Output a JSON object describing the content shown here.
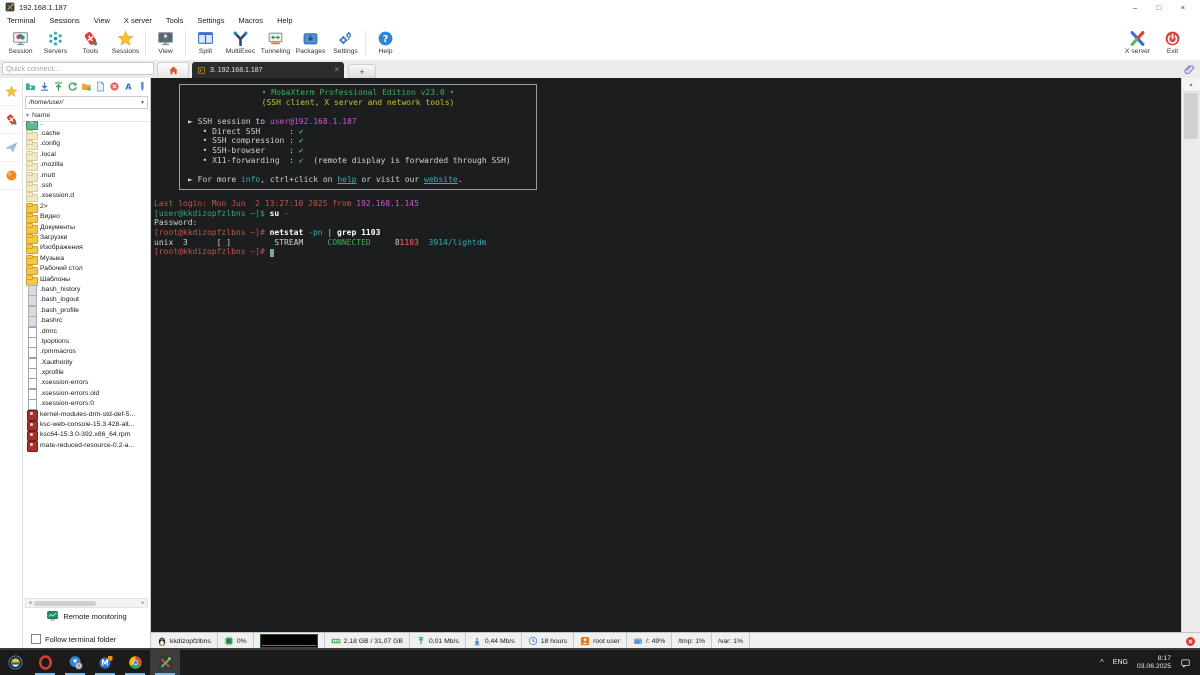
{
  "window": {
    "title": "192.168.1.187",
    "controls": [
      {
        "name": "minimize",
        "glyph": "–"
      },
      {
        "name": "maximize",
        "glyph": "□"
      },
      {
        "name": "close",
        "glyph": "×"
      }
    ]
  },
  "menu": [
    "Terminal",
    "Sessions",
    "View",
    "X server",
    "Tools",
    "Settings",
    "Macros",
    "Help"
  ],
  "toolbar": {
    "items": [
      {
        "name": "session",
        "icon": "session",
        "label": "Session"
      },
      {
        "name": "servers",
        "icon": "servers",
        "label": "Servers"
      },
      {
        "name": "tools",
        "icon": "knife",
        "label": "Tools"
      },
      {
        "name": "sessions",
        "icon": "star",
        "label": "Sessions"
      },
      {
        "name": "view",
        "icon": "view",
        "label": "View",
        "sep_before": true
      },
      {
        "name": "split",
        "icon": "split",
        "label": "Split",
        "sep_before": true
      },
      {
        "name": "multiexec",
        "icon": "multiexec",
        "label": "MultiExec"
      },
      {
        "name": "tunneling",
        "icon": "tunneling",
        "label": "Tunneling"
      },
      {
        "name": "packages",
        "icon": "packages",
        "label": "Packages"
      },
      {
        "name": "settings",
        "icon": "settings",
        "label": "Settings"
      },
      {
        "name": "help",
        "icon": "help",
        "label": "Help",
        "sep_before": true
      }
    ],
    "right_items": [
      {
        "name": "xserver",
        "icon": "xserver",
        "label": "X server"
      },
      {
        "name": "exit",
        "icon": "exit",
        "label": "Exit"
      }
    ]
  },
  "tabbar": {
    "quick_connect_placeholder": "Quick connect...",
    "active_tab": "3. 192.168.1.187"
  },
  "glyphs": {
    "new_tab": "+",
    "tab_close": "×",
    "sort_arrow": "▾",
    "path_chevron": "▾",
    "hscroll_left": "◂",
    "hscroll_right": "▸",
    "vscroll_up": "▴",
    "tray_chevron": "^"
  },
  "sidebar": {
    "strip_tabs": [
      {
        "name": "sessions-panel",
        "icon": "star"
      },
      {
        "name": "tools-panel",
        "icon": "knife"
      },
      {
        "name": "macros-panel",
        "icon": "plane"
      },
      {
        "name": "web-panel",
        "icon": "ball"
      }
    ],
    "browser_buttons": [
      {
        "name": "go-up-button",
        "icon": "fup"
      },
      {
        "name": "download-button",
        "icon": "fdown"
      },
      {
        "name": "upload-button",
        "icon": "fupload"
      },
      {
        "name": "refresh-button",
        "icon": "sync"
      },
      {
        "name": "open-folder-button",
        "icon": "ofolder"
      },
      {
        "name": "new-file-button",
        "icon": "nfile"
      },
      {
        "name": "delete-button",
        "icon": "fdelete"
      },
      {
        "name": "encoding-button",
        "icon": "enc"
      },
      {
        "name": "edit-button",
        "icon": "edit"
      }
    ],
    "path": "/home/user/",
    "column_header": "Name",
    "files": [
      {
        "name": "..",
        "icon": "folder-up"
      },
      {
        "name": ".cache",
        "icon": "folder-dim"
      },
      {
        "name": ".config",
        "icon": "folder-dim"
      },
      {
        "name": ".local",
        "icon": "folder-dim"
      },
      {
        "name": ".mozilla",
        "icon": "folder-dim"
      },
      {
        "name": ".mutt",
        "icon": "folder-dim"
      },
      {
        "name": ".ssh",
        "icon": "folder-dim"
      },
      {
        "name": ".xsession.d",
        "icon": "folder-dim"
      },
      {
        "name": "2>",
        "icon": "folder"
      },
      {
        "name": "Видео",
        "icon": "folder"
      },
      {
        "name": "Документы",
        "icon": "folder"
      },
      {
        "name": "Загрузки",
        "icon": "folder"
      },
      {
        "name": "Изображения",
        "icon": "folder"
      },
      {
        "name": "Музыка",
        "icon": "folder"
      },
      {
        "name": "Рабочий стол",
        "icon": "folder"
      },
      {
        "name": "Шаблоны",
        "icon": "folder"
      },
      {
        "name": ".bash_history",
        "icon": "file-dim"
      },
      {
        "name": ".bash_logout",
        "icon": "file-dim"
      },
      {
        "name": ".bash_profile",
        "icon": "file-dim"
      },
      {
        "name": ".bashrc",
        "icon": "file-dim"
      },
      {
        "name": ".dmrc",
        "icon": "file"
      },
      {
        "name": ".lpoptions",
        "icon": "file"
      },
      {
        "name": ".rpmmacros",
        "icon": "file"
      },
      {
        "name": ".Xauthority",
        "icon": "file"
      },
      {
        "name": ".xprofile",
        "icon": "file"
      },
      {
        "name": ".xsession-errors",
        "icon": "file"
      },
      {
        "name": ".xsession-errors.old",
        "icon": "file"
      },
      {
        "name": ".xsession-errors:0",
        "icon": "file"
      },
      {
        "name": "kernel-modules-drm-std-def-5...",
        "icon": "rpm"
      },
      {
        "name": "ksc-web-console-15.3.428-alt...",
        "icon": "rpm"
      },
      {
        "name": "ksc64-15.3.0-392.x86_64.rpm",
        "icon": "rpm"
      },
      {
        "name": "mate-reduced-resource-0.2-a...",
        "icon": "rpm"
      }
    ],
    "remote_monitoring_label": "Remote monitoring",
    "follow_terminal_label": "Follow terminal folder"
  },
  "terminal": {
    "colors": {
      "fg": "#cfd2d4",
      "bold": "#ffffff",
      "green": "#3cb054",
      "yellow": "#c6c62c",
      "magenta": "#cf56cf",
      "cyan": "#31b0b0",
      "red": "#c2564e",
      "teal": "#3aa376",
      "cursor_bg": "#7fa5a5"
    },
    "banner_lines": [
      {
        "align": "center",
        "segs": [
          {
            "t": "• MobaXterm Professional Edition v23.0 •",
            "c": "green"
          }
        ]
      },
      {
        "align": "center",
        "segs": [
          {
            "t": "(SSH client, X server and network tools)",
            "c": "yellow"
          }
        ]
      },
      {
        "segs": []
      },
      {
        "segs": [
          {
            "t": "► SSH session to ",
            "c": "fg"
          },
          {
            "t": "user@192.168.1.187",
            "c": "magenta"
          }
        ]
      },
      {
        "segs": [
          {
            "t": "   • Direct SSH      : ",
            "c": "fg"
          },
          {
            "t": "✔",
            "c": "green"
          }
        ]
      },
      {
        "segs": [
          {
            "t": "   • SSH compression : ",
            "c": "fg"
          },
          {
            "t": "✔",
            "c": "green"
          }
        ]
      },
      {
        "segs": [
          {
            "t": "   • SSH-browser     : ",
            "c": "fg"
          },
          {
            "t": "✔",
            "c": "green"
          }
        ]
      },
      {
        "segs": [
          {
            "t": "   • X11-forwarding  : ",
            "c": "fg"
          },
          {
            "t": "✔",
            "c": "green"
          },
          {
            "t": "  (remote display is forwarded through SSH)",
            "c": "fg"
          }
        ]
      },
      {
        "segs": []
      },
      {
        "segs": [
          {
            "t": "► For more ",
            "c": "fg"
          },
          {
            "t": "info",
            "c": "cyan"
          },
          {
            "t": ", ctrl+click on ",
            "c": "fg"
          },
          {
            "t": "help",
            "c": "cyan",
            "u": true
          },
          {
            "t": " or visit our ",
            "c": "fg"
          },
          {
            "t": "website",
            "c": "cyan",
            "u": true
          },
          {
            "t": ".",
            "c": "fg"
          }
        ]
      }
    ],
    "body_lines": [
      {
        "segs": [
          {
            "t": "Last login: Mon Jun  2 13:27:10 2025 from ",
            "c": "red"
          },
          {
            "t": "192.168.1.145",
            "c": "magenta"
          }
        ]
      },
      {
        "segs": [
          {
            "t": "[user@kkdizopfzlbns ~]$ ",
            "c": "teal"
          },
          {
            "t": "su ",
            "c": "bold",
            "b": true
          },
          {
            "t": "-",
            "c": "cyan"
          }
        ]
      },
      {
        "segs": [
          {
            "t": "Password:",
            "c": "fg"
          }
        ]
      },
      {
        "segs": [
          {
            "t": "[root@kkdizopfzlbns ~]# ",
            "c": "red"
          },
          {
            "t": "netstat ",
            "c": "bold",
            "b": true
          },
          {
            "t": "-pn",
            "c": "cyan"
          },
          {
            "t": " | ",
            "c": "fg"
          },
          {
            "t": "grep 1103",
            "c": "bold",
            "b": true
          }
        ]
      },
      {
        "segs": [
          {
            "t": "unix  3      [ ]         STREAM     ",
            "c": "fg"
          },
          {
            "t": "CONNECTED",
            "c": "green"
          },
          {
            "t": "     8",
            "c": "fg"
          },
          {
            "t": "1103",
            "c": "red",
            "b": true
          },
          {
            "t": "  3914/lightdm",
            "c": "cyan"
          }
        ]
      },
      {
        "segs": [
          {
            "t": "[root@kkdizopfzlbns ~]# ",
            "c": "red"
          },
          {
            "t": " ",
            "c": "fg",
            "cursor": true
          }
        ]
      }
    ]
  },
  "statusbar": {
    "segments": [
      {
        "name": "host",
        "icon": "tux",
        "text": "kkdizopfzlbns"
      },
      {
        "name": "cpu",
        "icon": "cpu",
        "text": "0%"
      },
      {
        "name": "graph",
        "icon": "graph",
        "text": ""
      },
      {
        "name": "ram",
        "icon": "ram",
        "text": "2,18 GB / 31,07 GB"
      },
      {
        "name": "upload",
        "icon": "netup",
        "text": "0,01 Mb/s"
      },
      {
        "name": "download",
        "icon": "netdown",
        "text": "0,44 Mb/s"
      },
      {
        "name": "uptime",
        "icon": "clock",
        "text": "18 hours"
      },
      {
        "name": "user",
        "icon": "user",
        "text": "root user"
      },
      {
        "name": "disk-root",
        "icon": "disk",
        "text": "/: 49%"
      },
      {
        "name": "disk-tmp",
        "icon": "",
        "text": "/tmp: 1%"
      },
      {
        "name": "disk-var",
        "icon": "",
        "text": "/var: 1%"
      }
    ]
  },
  "taskbar": {
    "items": [
      {
        "name": "start",
        "icon": "start",
        "running": false,
        "active": false
      },
      {
        "name": "opera",
        "icon": "opera",
        "running": true,
        "active": false
      },
      {
        "name": "clock-app",
        "icon": "clockapp",
        "running": true,
        "active": false
      },
      {
        "name": "m-app",
        "icon": "mapp",
        "running": true,
        "active": false
      },
      {
        "name": "chrome",
        "icon": "chrome",
        "running": true,
        "active": false
      },
      {
        "name": "mobaxterm",
        "icon": "moba",
        "running": true,
        "active": true
      }
    ],
    "tray": {
      "lang": "ENG",
      "time": "8:17",
      "date": "03.06.2025"
    }
  }
}
